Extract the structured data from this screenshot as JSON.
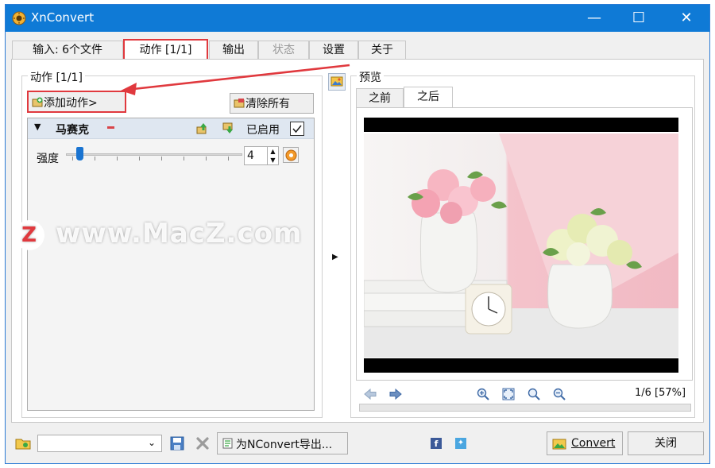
{
  "window": {
    "title": "XnConvert"
  },
  "tabs": [
    {
      "label": "输入:  6个文件",
      "state": "normal"
    },
    {
      "label": "动作 [1/1]",
      "state": "active"
    },
    {
      "label": "输出",
      "state": "normal"
    },
    {
      "label": "状态",
      "state": "disabled"
    },
    {
      "label": "设置",
      "state": "normal"
    },
    {
      "label": "关于",
      "state": "normal"
    }
  ],
  "actions_panel": {
    "legend": "动作 [1/1]",
    "add_button": "添加动作>",
    "clear_button": "清除所有",
    "action": {
      "name": "马赛克",
      "enabled_label": "已启用",
      "enabled": true
    },
    "strength": {
      "label": "强度",
      "value": "4",
      "slider_fraction": 0.06
    }
  },
  "preview": {
    "legend": "预览",
    "tabs": [
      "之前",
      "之后"
    ],
    "active_tab": "之后",
    "page_info": "1/6 [57%]"
  },
  "bottom": {
    "preset_value": "",
    "export_button": "为NConvert导出...",
    "convert_button": "Convert",
    "close_button": "关闭"
  },
  "watermark": {
    "logo": "Z",
    "text": "www.MacZ.com"
  },
  "colors": {
    "titlebar": "#0f7ad6",
    "highlight": "#e0393e",
    "action_header": "#dfe7f1"
  }
}
